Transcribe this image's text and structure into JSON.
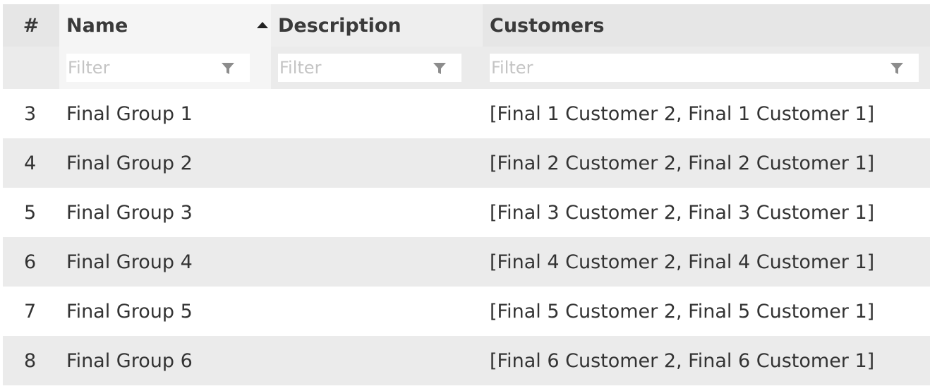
{
  "table": {
    "columns": {
      "num": "#",
      "name": "Name",
      "description": "Description",
      "customers": "Customers"
    },
    "sort": {
      "column": "Name",
      "direction": "ascending"
    },
    "filters": {
      "name_placeholder": "Filter",
      "description_placeholder": "Filter",
      "customers_placeholder": "Filter"
    },
    "rows": [
      {
        "num": "3",
        "name": "Final Group 1",
        "description": "",
        "customers": "[Final 1 Customer 2, Final 1 Customer 1]"
      },
      {
        "num": "4",
        "name": "Final Group 2",
        "description": "",
        "customers": "[Final 2 Customer 2, Final 2 Customer 1]"
      },
      {
        "num": "5",
        "name": "Final Group 3",
        "description": "",
        "customers": "[Final 3 Customer 2, Final 3 Customer 1]"
      },
      {
        "num": "6",
        "name": "Final Group 4",
        "description": "",
        "customers": "[Final 4 Customer 2, Final 4 Customer 1]"
      },
      {
        "num": "7",
        "name": "Final Group 5",
        "description": "",
        "customers": "[Final 5 Customer 2, Final 5 Customer 1]"
      },
      {
        "num": "8",
        "name": "Final Group 6",
        "description": "",
        "customers": "[Final 6 Customer 2, Final 6 Customer 1]"
      }
    ]
  },
  "icons": {
    "sort": "sort-ascending-icon",
    "filter": "filter-funnel-icon"
  },
  "colors": {
    "header_bg": "#e6e6e6",
    "sorted_header_bg": "#f5f5f5",
    "stripe_bg": "#ebebeb",
    "text": "#333333",
    "placeholder": "#c4c4c4",
    "filter_icon": "#8c8c8c"
  }
}
